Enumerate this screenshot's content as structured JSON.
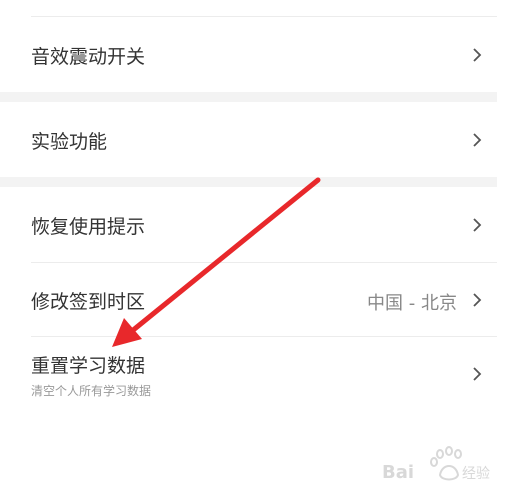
{
  "settings": {
    "sound_vibration": {
      "label": "音效震动开关"
    },
    "experimental": {
      "label": "实验功能"
    },
    "restore_tips": {
      "label": "恢复使用提示"
    },
    "timezone": {
      "label": "修改签到时区",
      "value": "中国 - 北京"
    },
    "reset_data": {
      "label": "重置学习数据",
      "sublabel": "清空个人所有学习数据"
    }
  },
  "annotation": {
    "arrow_color": "#e8282b",
    "watermark": "Bai经验"
  },
  "colors": {
    "text": "#333333",
    "secondary": "#999999",
    "divider": "#ececec",
    "gap": "#f3f3f3"
  }
}
